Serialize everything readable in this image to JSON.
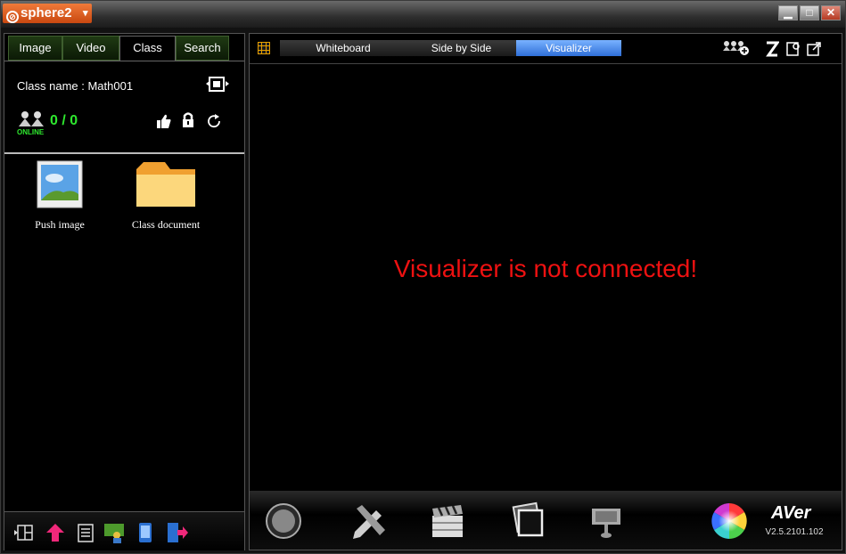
{
  "app": {
    "title": "sphere2"
  },
  "left_tabs": [
    {
      "label": "Image"
    },
    {
      "label": "Video"
    },
    {
      "label": "Class"
    },
    {
      "label": "Search"
    }
  ],
  "class_info": {
    "class_name": "Class name : Math001",
    "online_count": "0 / 0",
    "online_label": "ONLINE"
  },
  "files": [
    {
      "label": "Push image",
      "icon": "picture-icon"
    },
    {
      "label": "Class document",
      "icon": "folder-icon"
    }
  ],
  "right_tabs": [
    {
      "label": "Whiteboard"
    },
    {
      "label": "Side by Side"
    },
    {
      "label": "Visualizer"
    }
  ],
  "message": "Visualizer is not connected!",
  "brand": {
    "logo": "AVer",
    "version": "V2.5.2101.102"
  },
  "colors": {
    "accent": "#e8641e",
    "message": "#ee1111",
    "online": "#2ee82e",
    "active_tab": "#4a8ef0"
  }
}
